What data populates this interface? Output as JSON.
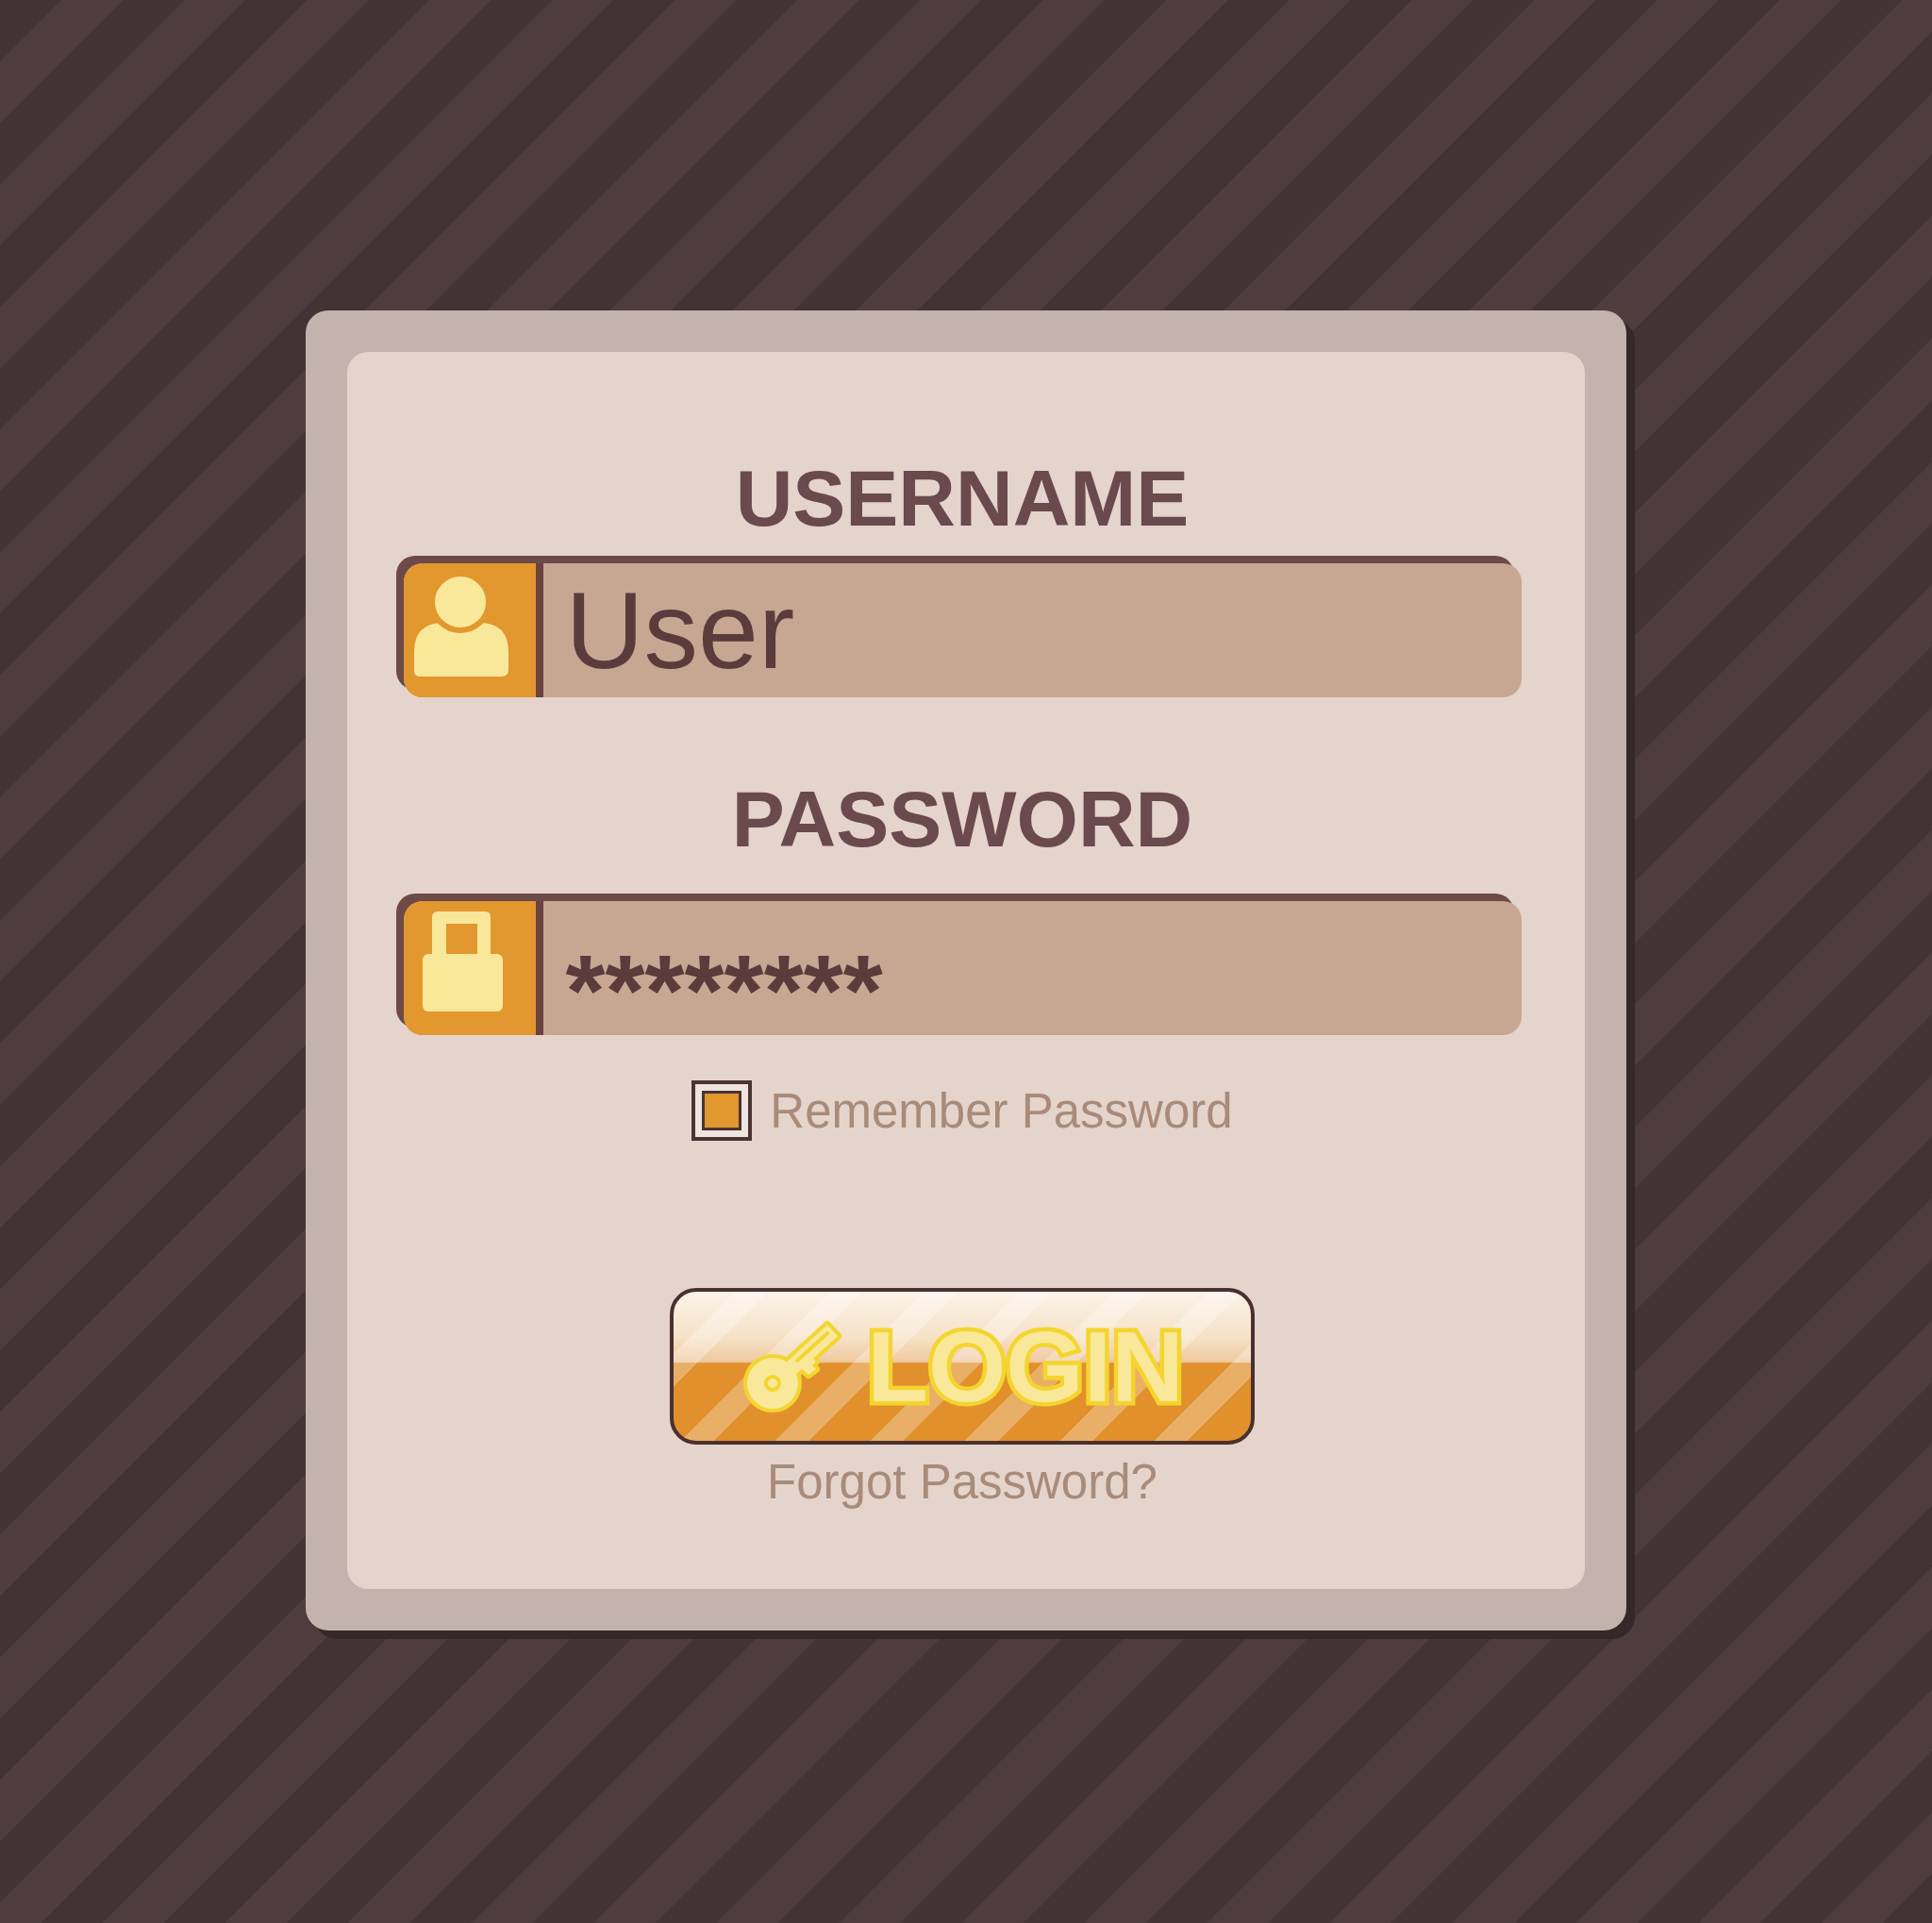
{
  "fields": [
    {
      "kind": "username",
      "label": "USERNAME",
      "value": "User"
    },
    {
      "kind": "password",
      "label": "PASSWORD",
      "value": "********"
    }
  ],
  "remember": {
    "label": "Remember Password",
    "checked": true
  },
  "login_button": {
    "label": "LOGIN"
  },
  "forgot_link": {
    "label": "Forgot Password?"
  }
}
